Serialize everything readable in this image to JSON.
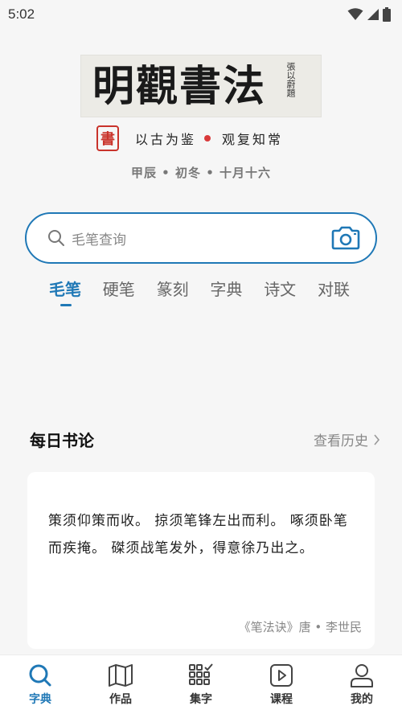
{
  "status_bar": {
    "time": "5:02",
    "icons": [
      "wifi-icon",
      "signal-icon",
      "battery-icon"
    ]
  },
  "logo": {
    "calligraphy": "明觀書法",
    "signature": "張以蔚題"
  },
  "motto": {
    "seal": "書",
    "left": "以古为鉴",
    "right": "观复知常"
  },
  "lunar_date": "甲辰 • 初冬 • 十月十六",
  "search": {
    "placeholder": "毛笔查询"
  },
  "tabs": [
    {
      "label": "毛笔",
      "active": true
    },
    {
      "label": "硬笔"
    },
    {
      "label": "篆刻"
    },
    {
      "label": "字典"
    },
    {
      "label": "诗文"
    },
    {
      "label": "对联"
    }
  ],
  "daily": {
    "title": "每日书论",
    "history_label": "查看历史",
    "quote": "策须仰策而收。 掠须笔锋左出而利。 啄须卧笔而疾掩。 磔须战笔发外，得意徐乃出之。",
    "source": "《笔法诀》唐 • 李世民"
  },
  "bottom_nav": [
    {
      "label": "字典",
      "icon": "search-icon",
      "active": true
    },
    {
      "label": "作品",
      "icon": "map-book-icon"
    },
    {
      "label": "集字",
      "icon": "grid-check-icon"
    },
    {
      "label": "课程",
      "icon": "play-icon"
    },
    {
      "label": "我的",
      "icon": "person-icon"
    }
  ],
  "colors": {
    "accent": "#1f78b6",
    "seal_red": "#c9332b",
    "background": "#f6f6f6"
  }
}
